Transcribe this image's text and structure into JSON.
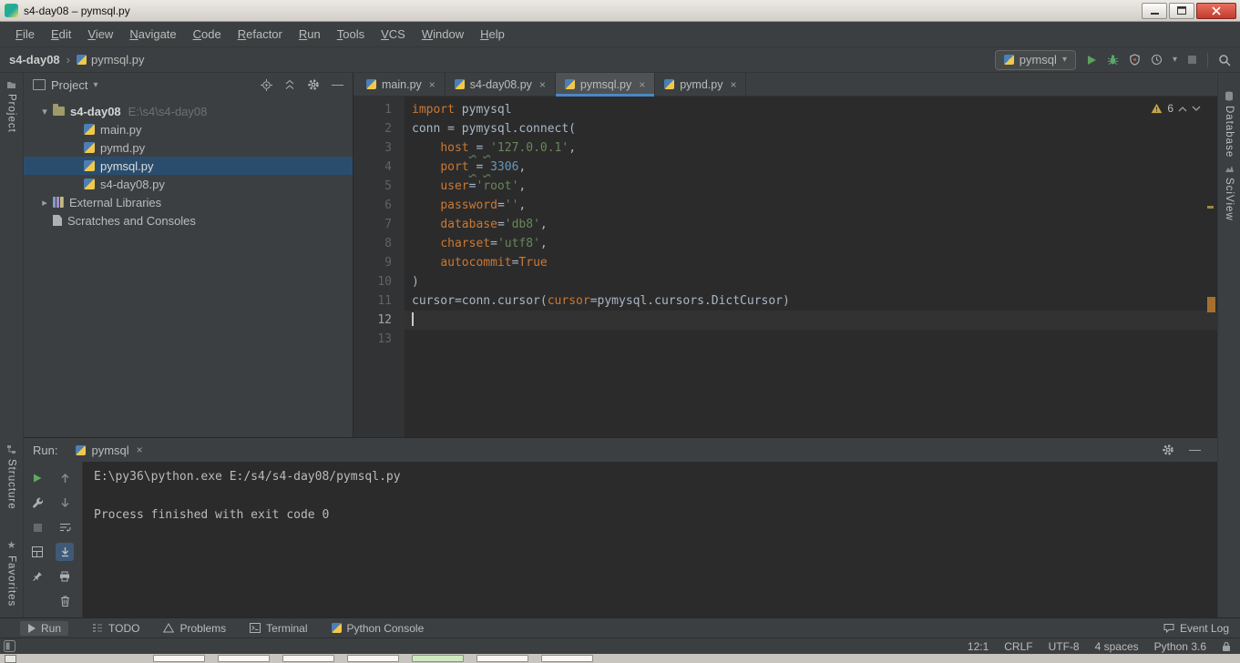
{
  "titlebar": {
    "title": "s4-day08 – pymsql.py"
  },
  "menu": {
    "items": [
      "File",
      "Edit",
      "View",
      "Navigate",
      "Code",
      "Refactor",
      "Run",
      "Tools",
      "VCS",
      "Window",
      "Help"
    ]
  },
  "navbar": {
    "project": "s4-day08",
    "file": "pymsql.py",
    "run_config": "pymsql"
  },
  "stripes": {
    "left": [
      "Project",
      "Structure",
      "Favorites"
    ],
    "right": [
      "Database",
      "SciView"
    ]
  },
  "project": {
    "header": "Project",
    "tree": [
      {
        "label": "s4-day08",
        "detail": "E:\\s4\\s4-day08",
        "icon": "folder",
        "indent": 1,
        "arrow": "down",
        "bold": true
      },
      {
        "label": "main.py",
        "icon": "python-file",
        "indent": 2
      },
      {
        "label": "pymd.py",
        "icon": "python-file",
        "indent": 2
      },
      {
        "label": "pymsql.py",
        "icon": "python-file",
        "indent": 2,
        "selected": true
      },
      {
        "label": "s4-day08.py",
        "icon": "python-file",
        "indent": 2
      },
      {
        "label": "External Libraries",
        "icon": "library",
        "indent": 1,
        "arrow": "right"
      },
      {
        "label": "Scratches and Consoles",
        "icon": "scratch",
        "indent": 1
      }
    ]
  },
  "tabs": {
    "items": [
      {
        "label": "main.py"
      },
      {
        "label": "s4-day08.py"
      },
      {
        "label": "pymsql.py",
        "active": true
      },
      {
        "label": "pymd.py"
      }
    ]
  },
  "editor": {
    "warnings": "6",
    "caret_line": 12,
    "lines": [
      {
        "n": "1",
        "tokens": [
          [
            "kw",
            "import"
          ],
          [
            "d",
            " pymysql"
          ]
        ]
      },
      {
        "n": "2",
        "tokens": [
          [
            "d",
            "conn = pymysql.connect("
          ]
        ]
      },
      {
        "n": "3",
        "tokens": [
          [
            "d",
            "    "
          ],
          [
            "p",
            "host"
          ],
          [
            "wsq",
            " "
          ],
          [
            "d",
            "="
          ],
          [
            "wsq",
            " "
          ],
          [
            "s",
            "'127.0.0.1'"
          ],
          [
            "d",
            ","
          ]
        ]
      },
      {
        "n": "4",
        "tokens": [
          [
            "d",
            "    "
          ],
          [
            "p",
            "port"
          ],
          [
            "wsq",
            " "
          ],
          [
            "d",
            "="
          ],
          [
            "wsq",
            " "
          ],
          [
            "n",
            "3306"
          ],
          [
            "d",
            ","
          ]
        ]
      },
      {
        "n": "5",
        "tokens": [
          [
            "d",
            "    "
          ],
          [
            "p",
            "user"
          ],
          [
            "d",
            "="
          ],
          [
            "s",
            "'root'"
          ],
          [
            "d",
            ","
          ]
        ]
      },
      {
        "n": "6",
        "tokens": [
          [
            "d",
            "    "
          ],
          [
            "p",
            "password"
          ],
          [
            "d",
            "="
          ],
          [
            "s",
            "''"
          ],
          [
            "d",
            ","
          ]
        ]
      },
      {
        "n": "7",
        "tokens": [
          [
            "d",
            "    "
          ],
          [
            "p",
            "database"
          ],
          [
            "d",
            "="
          ],
          [
            "s",
            "'db8'"
          ],
          [
            "d",
            ","
          ]
        ]
      },
      {
        "n": "8",
        "tokens": [
          [
            "d",
            "    "
          ],
          [
            "p",
            "charset"
          ],
          [
            "d",
            "="
          ],
          [
            "s",
            "'utf8'"
          ],
          [
            "d",
            ","
          ]
        ]
      },
      {
        "n": "9",
        "tokens": [
          [
            "d",
            "    "
          ],
          [
            "p",
            "autocommit"
          ],
          [
            "d",
            "="
          ],
          [
            "kw",
            "True"
          ]
        ]
      },
      {
        "n": "10",
        "tokens": [
          [
            "d",
            ")"
          ]
        ]
      },
      {
        "n": "11",
        "tokens": [
          [
            "d",
            "cursor=conn.cursor("
          ],
          [
            "p",
            "cursor"
          ],
          [
            "d",
            "=pymysql.cursors.DictCursor)"
          ]
        ]
      },
      {
        "n": "12",
        "tokens": []
      },
      {
        "n": "13",
        "tokens": []
      }
    ]
  },
  "run_panel": {
    "label": "Run:",
    "tab": "pymsql",
    "console": [
      "E:\\py36\\python.exe E:/s4/s4-day08/pymsql.py",
      "",
      "Process finished with exit code 0"
    ]
  },
  "bottom_bar": {
    "items": [
      {
        "label": "Run"
      },
      {
        "label": "TODO"
      },
      {
        "label": "Problems"
      },
      {
        "label": "Terminal"
      },
      {
        "label": "Python Console"
      }
    ],
    "event_log": "Event Log"
  },
  "status_bar": {
    "items": [
      "12:1",
      "CRLF",
      "UTF-8",
      "4 spaces",
      "Python 3.6"
    ]
  },
  "taskbar": {
    "buttons": [
      "normal",
      "normal",
      "normal",
      "normal",
      "green",
      "normal",
      "normal"
    ]
  }
}
